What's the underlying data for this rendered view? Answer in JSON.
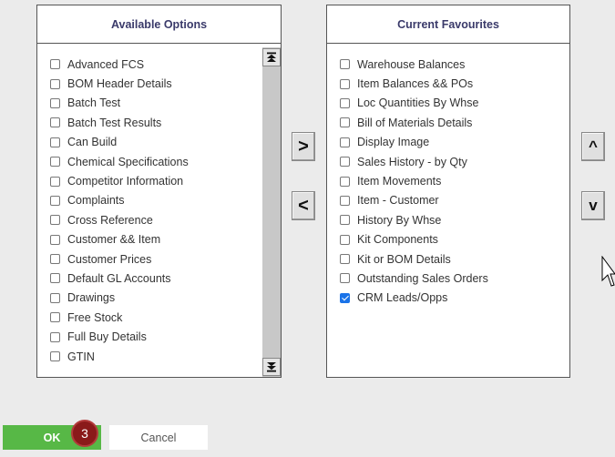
{
  "available": {
    "title": "Available Options",
    "items": [
      {
        "label": "Advanced FCS",
        "checked": false
      },
      {
        "label": "BOM Header Details",
        "checked": false
      },
      {
        "label": "Batch Test",
        "checked": false
      },
      {
        "label": "Batch Test Results",
        "checked": false
      },
      {
        "label": "Can Build",
        "checked": false
      },
      {
        "label": "Chemical Specifications",
        "checked": false
      },
      {
        "label": "Competitor Information",
        "checked": false
      },
      {
        "label": "Complaints",
        "checked": false
      },
      {
        "label": "Cross Reference",
        "checked": false
      },
      {
        "label": "Customer && Item",
        "checked": false
      },
      {
        "label": "Customer Prices",
        "checked": false
      },
      {
        "label": "Default GL Accounts",
        "checked": false
      },
      {
        "label": "Drawings",
        "checked": false
      },
      {
        "label": "Free Stock",
        "checked": false
      },
      {
        "label": "Full Buy Details",
        "checked": false
      },
      {
        "label": "GTIN",
        "checked": false
      }
    ]
  },
  "favourites": {
    "title": "Current Favourites",
    "items": [
      {
        "label": "Warehouse Balances",
        "checked": false
      },
      {
        "label": "Item Balances && POs",
        "checked": false
      },
      {
        "label": "Loc Quantities By Whse",
        "checked": false
      },
      {
        "label": "Bill of Materials Details",
        "checked": false
      },
      {
        "label": "Display Image",
        "checked": false
      },
      {
        "label": "Sales History - by Qty",
        "checked": false
      },
      {
        "label": "Item Movements",
        "checked": false
      },
      {
        "label": "Item - Customer",
        "checked": false
      },
      {
        "label": "History By Whse",
        "checked": false
      },
      {
        "label": "Kit Components",
        "checked": false
      },
      {
        "label": "Kit or BOM Details",
        "checked": false
      },
      {
        "label": "Outstanding Sales Orders",
        "checked": false
      },
      {
        "label": "CRM Leads/Opps",
        "checked": true
      }
    ]
  },
  "buttons": {
    "add": ">",
    "remove": "<",
    "move_up": "^",
    "move_down": "v",
    "ok": "OK",
    "cancel": "Cancel"
  },
  "step_badge": "3",
  "colors": {
    "ok_green": "#57b846",
    "badge_red": "#8a1a1a",
    "checkbox_blue": "#1a73e8",
    "header_text": "#3a3a6a"
  }
}
